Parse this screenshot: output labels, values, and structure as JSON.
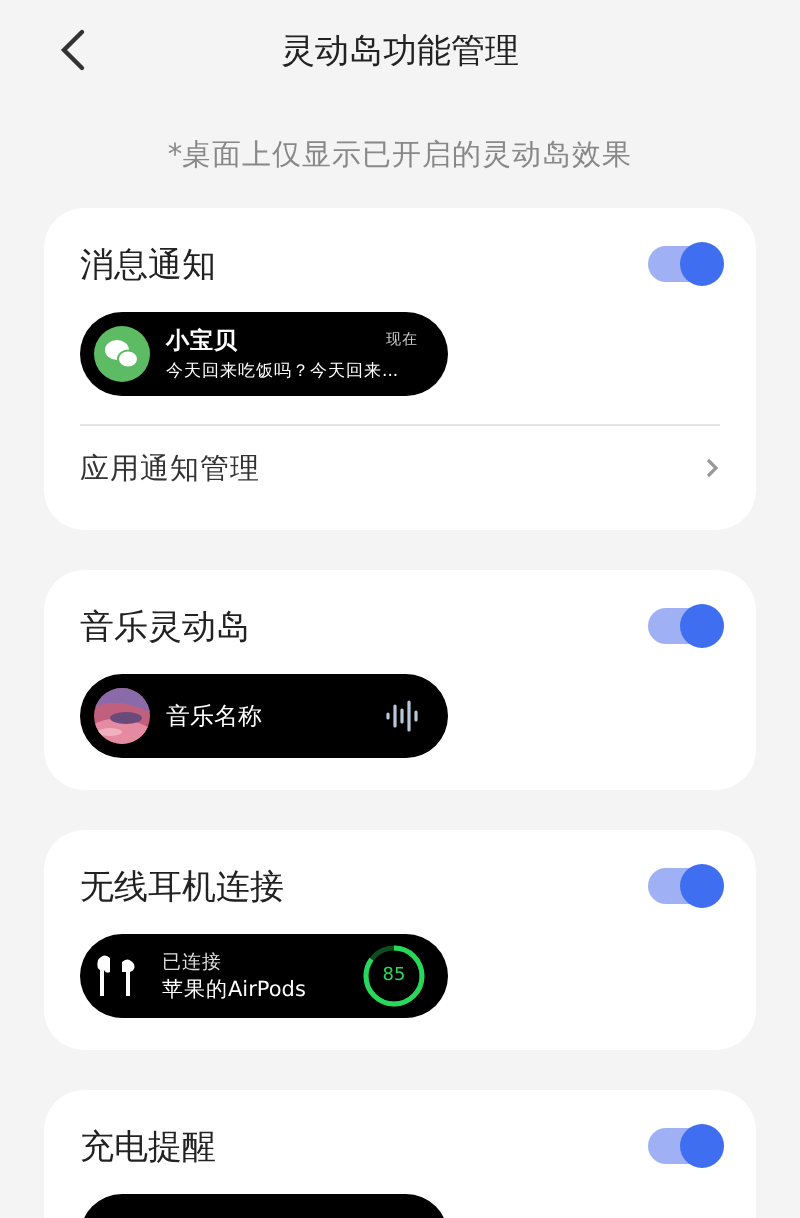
{
  "header": {
    "title": "灵动岛功能管理"
  },
  "note": "*桌面上仅显示已开启的灵动岛效果",
  "sections": [
    {
      "kind": "notification",
      "title": "消息通知",
      "on": true,
      "preview": {
        "sender": "小宝贝",
        "time": "现在",
        "message": "今天回来吃饭吗？今天回来..."
      },
      "link": "应用通知管理"
    },
    {
      "kind": "music",
      "title": "音乐灵动岛",
      "on": true,
      "preview": {
        "song": "音乐名称"
      }
    },
    {
      "kind": "earbuds",
      "title": "无线耳机连接",
      "on": true,
      "preview": {
        "status": "已连接",
        "device": "苹果的AirPods",
        "battery": "85",
        "level": 0.85
      }
    },
    {
      "kind": "charging",
      "title": "充电提醒",
      "on": true
    }
  ]
}
